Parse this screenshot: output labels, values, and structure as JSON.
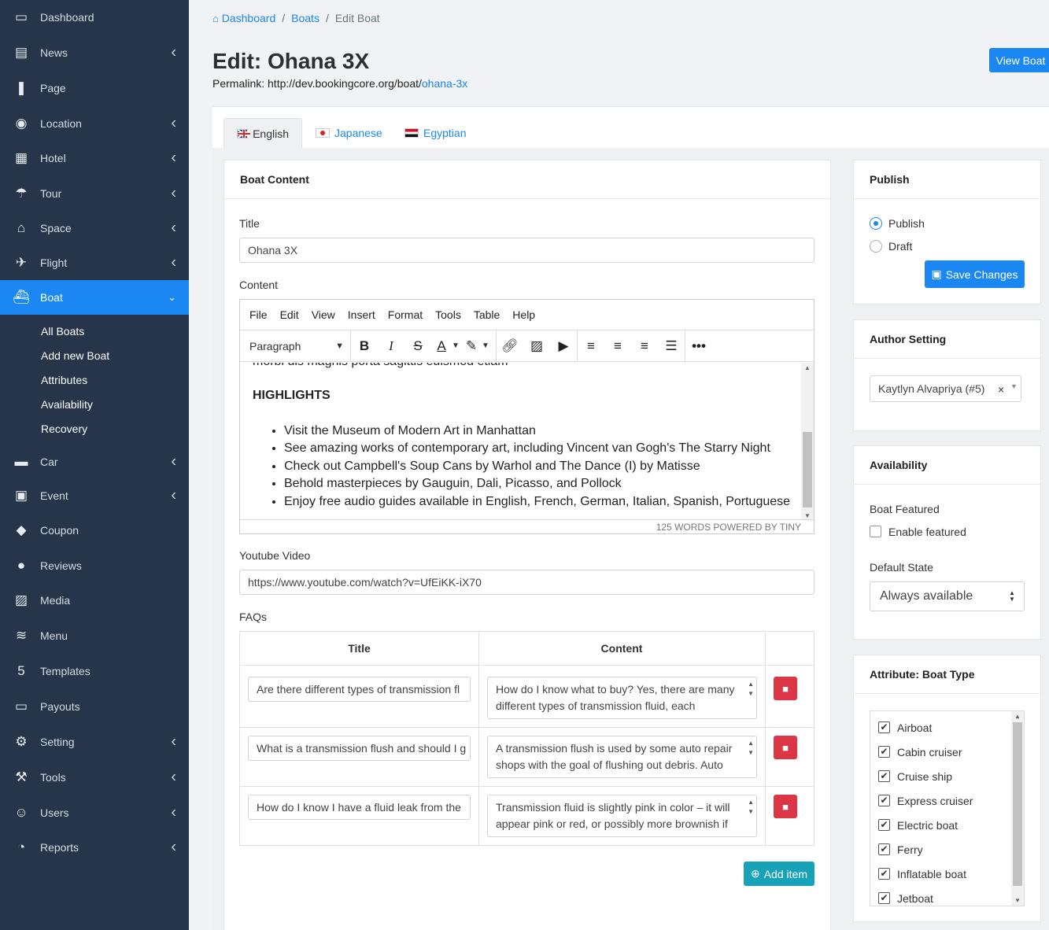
{
  "sidebar": {
    "items": [
      {
        "label": "Dashboard",
        "icon": "monitor-icon",
        "glyph": "▭",
        "chevron": false
      },
      {
        "label": "News",
        "icon": "news-icon",
        "glyph": "▤",
        "chevron": true
      },
      {
        "label": "Page",
        "icon": "book-icon",
        "glyph": "❚",
        "chevron": false
      },
      {
        "label": "Location",
        "icon": "compass-icon",
        "glyph": "◉",
        "chevron": true
      },
      {
        "label": "Hotel",
        "icon": "building-icon",
        "glyph": "▦",
        "chevron": true
      },
      {
        "label": "Tour",
        "icon": "umbrella-icon",
        "glyph": "☂",
        "chevron": true
      },
      {
        "label": "Space",
        "icon": "home-icon",
        "glyph": "⌂",
        "chevron": true
      },
      {
        "label": "Flight",
        "icon": "plane-icon",
        "glyph": "✈",
        "chevron": true
      },
      {
        "label": "Boat",
        "icon": "ship-icon",
        "glyph": "⛴",
        "chevron": true
      },
      {
        "label": "Car",
        "icon": "car-icon",
        "glyph": "▬",
        "chevron": true
      },
      {
        "label": "Event",
        "icon": "calendar-icon",
        "glyph": "▣",
        "chevron": true
      },
      {
        "label": "Coupon",
        "icon": "ticket-icon",
        "glyph": "◆",
        "chevron": false
      },
      {
        "label": "Reviews",
        "icon": "comment-icon",
        "glyph": "●",
        "chevron": false
      },
      {
        "label": "Media",
        "icon": "image-icon",
        "glyph": "▨",
        "chevron": false
      },
      {
        "label": "Menu",
        "icon": "layers-icon",
        "glyph": "≋",
        "chevron": false
      },
      {
        "label": "Templates",
        "icon": "html5-icon",
        "glyph": "5",
        "chevron": false
      },
      {
        "label": "Payouts",
        "icon": "credit-card-icon",
        "glyph": "▭",
        "chevron": false
      },
      {
        "label": "Setting",
        "icon": "gear-icon",
        "glyph": "⚙",
        "chevron": true
      },
      {
        "label": "Tools",
        "icon": "hammer-icon",
        "glyph": "⚒",
        "chevron": true
      },
      {
        "label": "Users",
        "icon": "users-icon",
        "glyph": "☺",
        "chevron": true
      },
      {
        "label": "Reports",
        "icon": "pie-chart-icon",
        "glyph": "◔",
        "chevron": true
      }
    ],
    "boat_subitems": [
      "All Boats",
      "Add new Boat",
      "Attributes",
      "Availability",
      "Recovery"
    ]
  },
  "breadcrumb": {
    "home": "Dashboard",
    "section": "Boats",
    "current": "Edit Boat",
    "separator": "/"
  },
  "page": {
    "title": "Edit: Ohana 3X",
    "permalink_label": "Permalink: http://dev.bookingcore.org/boat/",
    "permalink_slug": "ohana-3x",
    "view_button": "View Boat"
  },
  "languages": [
    {
      "label": "English",
      "flag": "uk-flag-icon"
    },
    {
      "label": "Japanese",
      "flag": "japan-flag-icon"
    },
    {
      "label": "Egyptian",
      "flag": "egypt-flag-icon"
    }
  ],
  "boat_content": {
    "heading": "Boat Content",
    "title_label": "Title",
    "title_value": "Ohana 3X",
    "content_label": "Content",
    "editor": {
      "menu": [
        "File",
        "Edit",
        "View",
        "Insert",
        "Format",
        "Tools",
        "Table",
        "Help"
      ],
      "block_format": "Paragraph",
      "cut_off_line": "morbi dis magnis porta sagittis euismod etiam",
      "heading": "HIGHLIGHTS",
      "bullets": [
        "Visit the Museum of Modern Art in Manhattan",
        "See amazing works of contemporary art, including Vincent van Gogh's The Starry Night",
        "Check out Campbell's Soup Cans by Warhol and The Dance (I) by Matisse",
        "Behold masterpieces by Gauguin, Dali, Picasso, and Pollock",
        "Enjoy free audio guides available in English, French, German, Italian, Spanish, Portuguese"
      ],
      "status": "125 WORDS  POWERED BY TINY"
    },
    "youtube_label": "Youtube Video",
    "youtube_value": "https://www.youtube.com/watch?v=UfEiKK-iX70",
    "faqs_label": "FAQs",
    "faq_columns": [
      "Title",
      "Content"
    ],
    "faqs": [
      {
        "title": "Are there different types of transmission fl",
        "content": "How do I know what to buy? Yes, there are many different types of transmission fluid, each"
      },
      {
        "title": "What is a transmission flush and should I g",
        "content": "A transmission flush is used by some auto repair shops with the goal of flushing out debris.  Auto"
      },
      {
        "title": "How do I know I have a fluid leak from the",
        "content": "Transmission fluid is slightly pink in color – it will appear pink or red, or possibly more brownish if"
      }
    ],
    "add_item": "Add item"
  },
  "publish": {
    "heading": "Publish",
    "options": [
      "Publish",
      "Draft"
    ],
    "selected": "Publish",
    "save_button": "Save Changes"
  },
  "author": {
    "heading": "Author Setting",
    "value": "Kaytlyn Alvapriya (#5)",
    "clear": "×"
  },
  "availability": {
    "heading": "Availability",
    "featured_label": "Boat Featured",
    "enable_featured": "Enable featured",
    "default_state_label": "Default State",
    "default_state_value": "Always available"
  },
  "boat_type": {
    "heading": "Attribute: Boat Type",
    "items": [
      "Airboat",
      "Cabin cruiser",
      "Cruise ship",
      "Express cruiser",
      "Electric boat",
      "Ferry",
      "Inflatable boat",
      "Jetboat"
    ]
  },
  "colors": {
    "sidebar": "#263549",
    "accent": "#1b87f2",
    "danger": "#dc3545",
    "teal": "#17a2b8"
  }
}
